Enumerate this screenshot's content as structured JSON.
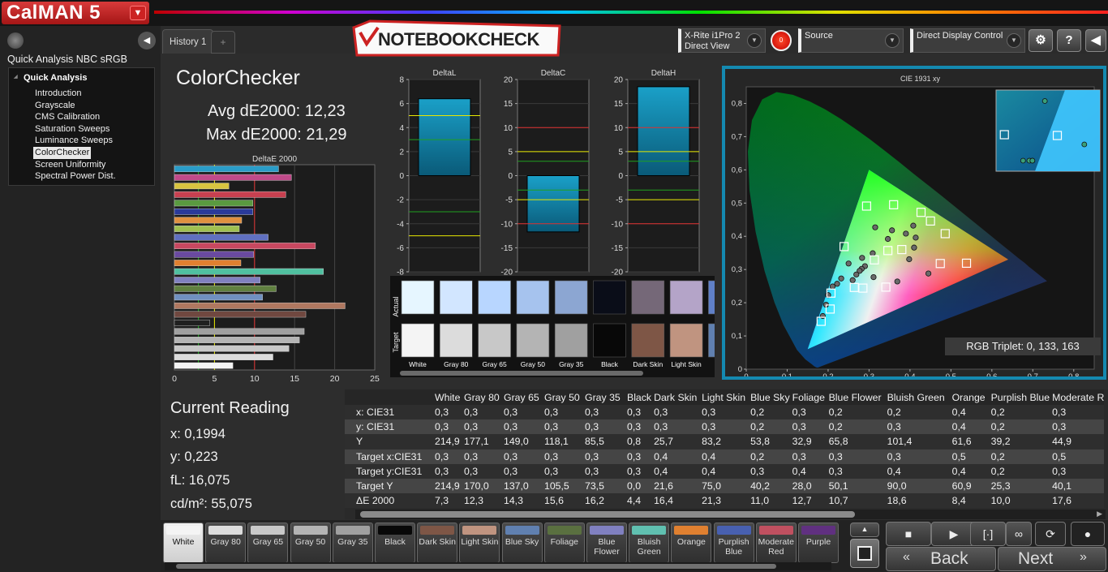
{
  "app": {
    "logo_text": "CalMAN 5",
    "logo_menu_icon": "chevron-down-icon"
  },
  "workflow": {
    "title": "Quick Analysis NBC sRGB",
    "root": "Quick Analysis",
    "items": [
      "Introduction",
      "Grayscale",
      "CMS Calibration",
      "Saturation Sweeps",
      "Luminance Sweeps",
      "ColorChecker",
      "Screen Uniformity",
      "Spectral Power Dist."
    ],
    "selected": "ColorChecker"
  },
  "tabs": {
    "history": "History 1",
    "add": "+"
  },
  "watermark": "NOTEBOOKCHECK",
  "devices": {
    "meter_line1": "X-Rite i1Pro 2",
    "meter_line2": "Direct View",
    "meter_status": "0",
    "source": "Source",
    "display": "Direct Display Control",
    "colors": {
      "meter": "#33cc33",
      "source": "#e8d800",
      "display": "#e8d800"
    }
  },
  "toolbar": {
    "settings_icon": "gear-icon",
    "help": "?",
    "back_icon": "chevron-left-icon"
  },
  "colorchecker": {
    "title": "ColorChecker",
    "avg": "Avg dE2000: 12,23",
    "max": "Max dE2000: 21,29"
  },
  "current_reading": {
    "title": "Current Reading",
    "x": "x: 0,1994",
    "y": "y: 0,223",
    "fl": "fL: 16,075",
    "cdm2": "cd/m²: 55,075"
  },
  "rgb_triplet": "RGB Triplet: 0, 133, 163",
  "chart_data": [
    {
      "type": "bar",
      "title": "DeltaE 2000",
      "orientation": "horizontal",
      "xlim": [
        0,
        25
      ],
      "xticks": [
        "0",
        "5",
        "10",
        "15",
        "20",
        "25"
      ],
      "reference_lines": [
        3,
        5,
        10
      ],
      "bars": [
        {
          "value": 13.0,
          "color": "#2a9cc8"
        },
        {
          "value": 14.6,
          "color": "#c04a8a"
        },
        {
          "value": 6.8,
          "color": "#d8c440"
        },
        {
          "value": 13.9,
          "color": "#c84050"
        },
        {
          "value": 9.8,
          "color": "#5a9a40"
        },
        {
          "value": 9.8,
          "color": "#2a3a9a"
        },
        {
          "value": 8.4,
          "color": "#e09040"
        },
        {
          "value": 8.1,
          "color": "#a0c050"
        },
        {
          "value": 11.7,
          "color": "#6070c0"
        },
        {
          "value": 17.6,
          "color": "#c84860"
        },
        {
          "value": 9.9,
          "color": "#6a4aa0"
        },
        {
          "value": 8.3,
          "color": "#e08030"
        },
        {
          "value": 18.6,
          "color": "#50c0a0"
        },
        {
          "value": 10.7,
          "color": "#8080c0"
        },
        {
          "value": 12.7,
          "color": "#608040"
        },
        {
          "value": 11.0,
          "color": "#7090c0"
        },
        {
          "value": 21.3,
          "color": "#b07860"
        },
        {
          "value": 16.4,
          "color": "#704840"
        },
        {
          "value": 4.4,
          "color": "#202020"
        },
        {
          "value": 16.2,
          "color": "#a0a0a0"
        },
        {
          "value": 15.6,
          "color": "#b4b4b4"
        },
        {
          "value": 14.3,
          "color": "#c8c8c8"
        },
        {
          "value": 12.3,
          "color": "#dcdcdc"
        },
        {
          "value": 7.3,
          "color": "#f4f4f4"
        }
      ]
    },
    {
      "type": "bar",
      "title": "DeltaL",
      "ylim": [
        -8,
        8
      ],
      "yticks": [
        "8",
        "6",
        "4",
        "2",
        "0",
        "-2",
        "-4",
        "-6",
        "-8"
      ],
      "values": [
        6.4
      ],
      "lines": [
        {
          "value": 5,
          "color": "#e8e800"
        },
        {
          "value": -5,
          "color": "#e8e800"
        },
        {
          "value": 3,
          "color": "#20a020"
        },
        {
          "value": -3,
          "color": "#20a020"
        }
      ]
    },
    {
      "type": "bar",
      "title": "DeltaC",
      "ylim": [
        -20,
        20
      ],
      "yticks": [
        "20",
        "15",
        "10",
        "5",
        "0",
        "-5",
        "-10",
        "-15",
        "-20"
      ],
      "values": [
        -11.7
      ],
      "lines": [
        {
          "value": 10,
          "color": "#e03030"
        },
        {
          "value": -10,
          "color": "#e03030"
        },
        {
          "value": 5,
          "color": "#e8e800"
        },
        {
          "value": -5,
          "color": "#e8e800"
        },
        {
          "value": 3,
          "color": "#20a020"
        },
        {
          "value": -3,
          "color": "#20a020"
        }
      ]
    },
    {
      "type": "bar",
      "title": "DeltaH",
      "ylim": [
        -20,
        20
      ],
      "yticks": [
        "20",
        "15",
        "10",
        "5",
        "0",
        "-5",
        "-10",
        "-15",
        "-20"
      ],
      "values": [
        18.5
      ],
      "lines": [
        {
          "value": 10,
          "color": "#e03030"
        },
        {
          "value": -10,
          "color": "#e03030"
        },
        {
          "value": 5,
          "color": "#e8e800"
        },
        {
          "value": -5,
          "color": "#e8e800"
        },
        {
          "value": 3,
          "color": "#20a020"
        },
        {
          "value": -3,
          "color": "#20a020"
        }
      ]
    },
    {
      "type": "scatter",
      "title": "CIE 1931 xy",
      "xlim": [
        0,
        0.85
      ],
      "ylim": [
        0,
        0.85
      ],
      "xticks": [
        "0",
        "0,1",
        "0,2",
        "0,3",
        "0,4",
        "0,5",
        "0,6",
        "0,7",
        "0,8"
      ],
      "yticks": [
        "0,8",
        "0,7",
        "0,6",
        "0,5",
        "0,4",
        "0,3",
        "0,2",
        "0,1",
        "0"
      ],
      "gamut": [
        [
          0.64,
          0.33
        ],
        [
          0.3,
          0.6
        ],
        [
          0.15,
          0.06
        ]
      ],
      "targets": [
        [
          0.313,
          0.329
        ],
        [
          0.264,
          0.246
        ],
        [
          0.207,
          0.229
        ],
        [
          0.205,
          0.181
        ],
        [
          0.183,
          0.144
        ],
        [
          0.239,
          0.369
        ],
        [
          0.294,
          0.491
        ],
        [
          0.36,
          0.495
        ],
        [
          0.427,
          0.472
        ],
        [
          0.45,
          0.446
        ],
        [
          0.486,
          0.408
        ],
        [
          0.346,
          0.357
        ],
        [
          0.38,
          0.36
        ],
        [
          0.474,
          0.318
        ],
        [
          0.538,
          0.319
        ],
        [
          0.285,
          0.244
        ],
        [
          0.341,
          0.247
        ]
      ],
      "measured": [
        [
          0.29,
          0.31
        ],
        [
          0.282,
          0.302
        ],
        [
          0.277,
          0.296
        ],
        [
          0.269,
          0.285
        ],
        [
          0.26,
          0.268
        ],
        [
          0.232,
          0.273
        ],
        [
          0.222,
          0.257
        ],
        [
          0.211,
          0.249
        ],
        [
          0.2,
          0.223
        ],
        [
          0.195,
          0.194
        ],
        [
          0.187,
          0.16
        ],
        [
          0.25,
          0.318
        ],
        [
          0.283,
          0.335
        ],
        [
          0.309,
          0.349
        ],
        [
          0.315,
          0.427
        ],
        [
          0.356,
          0.418
        ],
        [
          0.346,
          0.392
        ],
        [
          0.39,
          0.408
        ],
        [
          0.408,
          0.432
        ],
        [
          0.414,
          0.396
        ],
        [
          0.41,
          0.366
        ],
        [
          0.398,
          0.331
        ],
        [
          0.445,
          0.288
        ],
        [
          0.369,
          0.264
        ],
        [
          0.311,
          0.277
        ]
      ],
      "inset_targets": [
        [
          0.288,
          0.49
        ],
        [
          0.339,
          0.488
        ]
      ],
      "inset_measured": [
        [
          0.327,
          0.573
        ],
        [
          0.365,
          0.466
        ],
        [
          0.306,
          0.426
        ],
        [
          0.312,
          0.426
        ],
        [
          0.315,
          0.426
        ],
        [
          0.315,
          0.426
        ]
      ]
    }
  ],
  "swatches": {
    "actual_label": "Actual",
    "target_label": "Target",
    "items": [
      {
        "label": "White",
        "actual": "#e6f6ff",
        "target": "#f4f4f4"
      },
      {
        "label": "Gray 80",
        "actual": "#d2e6ff",
        "target": "#dcdcdc"
      },
      {
        "label": "Gray 65",
        "actual": "#b8d6ff",
        "target": "#c8c8c8"
      },
      {
        "label": "Gray 50",
        "actual": "#a6c3ee",
        "target": "#b4b4b4"
      },
      {
        "label": "Gray 35",
        "actual": "#8ca6d2",
        "target": "#a0a0a0"
      },
      {
        "label": "Black",
        "actual": "#0a0d18",
        "target": "#080808"
      },
      {
        "label": "Dark Skin",
        "actual": "#756878",
        "target": "#7e5646"
      },
      {
        "label": "Light Skin",
        "actual": "#b4a4c8",
        "target": "#c09480"
      },
      {
        "label": "B",
        "actual": "#6080c8",
        "target": "#6080b0"
      }
    ]
  },
  "table": {
    "columns": [
      "White",
      "Gray 80",
      "Gray 65",
      "Gray 50",
      "Gray 35",
      "Black",
      "Dark Skin",
      "Light Skin",
      "Blue Sky",
      "Foliage",
      "Blue Flower",
      "Bluish Green",
      "Orange",
      "Purplish Blue",
      "Moderate R"
    ],
    "rows": [
      {
        "label": "x: CIE31",
        "values": [
          "0,3",
          "0,3",
          "0,3",
          "0,3",
          "0,3",
          "0,3",
          "0,3",
          "0,3",
          "0,2",
          "0,3",
          "0,2",
          "0,2",
          "0,4",
          "0,2",
          "0,3"
        ]
      },
      {
        "label": "y: CIE31",
        "values": [
          "0,3",
          "0,3",
          "0,3",
          "0,3",
          "0,3",
          "0,3",
          "0,3",
          "0,3",
          "0,2",
          "0,3",
          "0,2",
          "0,3",
          "0,4",
          "0,2",
          "0,3"
        ]
      },
      {
        "label": "Y",
        "values": [
          "214,9",
          "177,1",
          "149,0",
          "118,1",
          "85,5",
          "0,8",
          "25,7",
          "83,2",
          "53,8",
          "32,9",
          "65,8",
          "101,4",
          "61,6",
          "39,2",
          "44,9"
        ]
      },
      {
        "label": "Target x:CIE31",
        "values": [
          "0,3",
          "0,3",
          "0,3",
          "0,3",
          "0,3",
          "0,3",
          "0,4",
          "0,4",
          "0,2",
          "0,3",
          "0,3",
          "0,3",
          "0,5",
          "0,2",
          "0,5"
        ]
      },
      {
        "label": "Target y:CIE31",
        "values": [
          "0,3",
          "0,3",
          "0,3",
          "0,3",
          "0,3",
          "0,3",
          "0,4",
          "0,4",
          "0,3",
          "0,4",
          "0,3",
          "0,4",
          "0,4",
          "0,2",
          "0,3"
        ]
      },
      {
        "label": "Target Y",
        "values": [
          "214,9",
          "170,0",
          "137,0",
          "105,5",
          "73,5",
          "0,0",
          "21,6",
          "75,0",
          "40,2",
          "28,0",
          "50,1",
          "90,0",
          "60,9",
          "25,3",
          "40,1"
        ]
      },
      {
        "label": "ΔE 2000",
        "values": [
          "7,3",
          "12,3",
          "14,3",
          "15,6",
          "16,2",
          "4,4",
          "16,4",
          "21,3",
          "11,0",
          "12,7",
          "10,7",
          "18,6",
          "8,4",
          "10,0",
          "17,6"
        ]
      }
    ]
  },
  "bottom_buttons": [
    {
      "label": "White",
      "color": "#f4f4f4"
    },
    {
      "label": "Gray 80",
      "color": "#dcdcdc"
    },
    {
      "label": "Gray 65",
      "color": "#c8c8c8"
    },
    {
      "label": "Gray 50",
      "color": "#b4b4b4"
    },
    {
      "label": "Gray 35",
      "color": "#a0a0a0"
    },
    {
      "label": "Black",
      "color": "#080808"
    },
    {
      "label": "Dark Skin",
      "color": "#7e5646"
    },
    {
      "label": "Light Skin",
      "color": "#c09480"
    },
    {
      "label": "Blue Sky",
      "color": "#6080b0"
    },
    {
      "label": "Foliage",
      "color": "#5a7040"
    },
    {
      "label": "Blue Flower",
      "color": "#8080c0"
    },
    {
      "label": "Bluish Green",
      "color": "#60c0b0"
    },
    {
      "label": "Orange",
      "color": "#e08030"
    },
    {
      "label": "Purplish Blue",
      "color": "#4860b0"
    },
    {
      "label": "Moderate Red",
      "color": "#c05060"
    },
    {
      "label": "Purple",
      "color": "#603080"
    }
  ],
  "navigation": {
    "back": "Back",
    "next": "Next",
    "back_icon": "double-chevron-left-icon",
    "next_icon": "double-chevron-right-icon"
  },
  "playback": {
    "stop_icon": "stop-icon",
    "play_icon": "play-icon",
    "step_icon": "step-icon",
    "loop_icon": "loop-icon",
    "refresh_icon": "refresh-icon",
    "record_icon": "record-icon",
    "big_stop_icon": "stop-square-icon",
    "up_icon": "chevron-up-icon",
    "down_icon": "chevron-down-icon"
  }
}
